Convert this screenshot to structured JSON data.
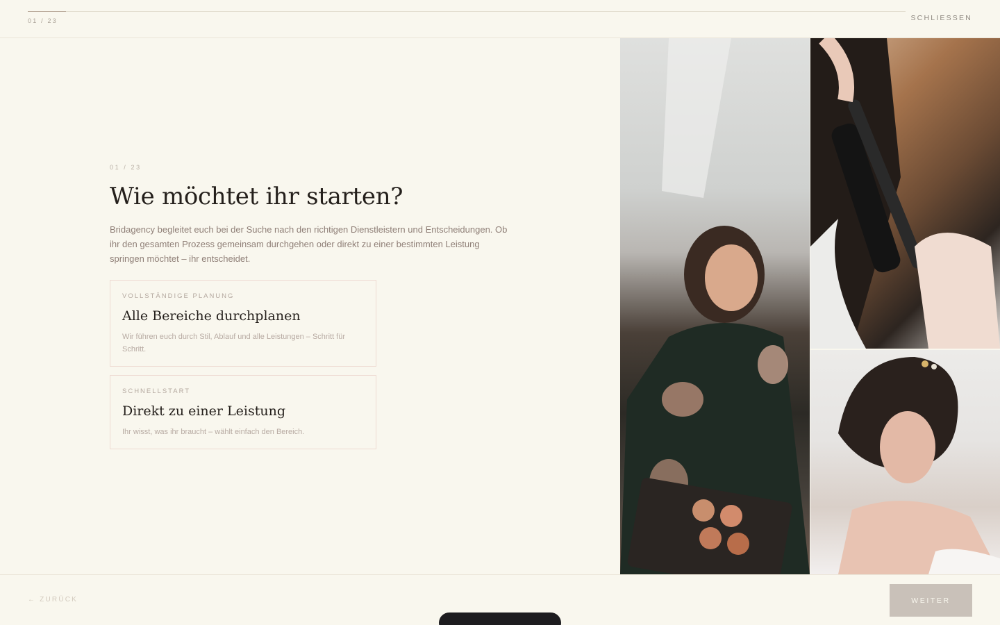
{
  "header": {
    "counter": "01 / 23",
    "progress": 0.0435,
    "close_label": "SCHLIESSEN"
  },
  "step": {
    "label": "01 / 23",
    "headline": "Wie möchtet ihr starten?",
    "intro": "Bridagency begleitet euch bei der Suche nach den richtigen Dienstleistern und Entscheidungen. Ob ihr den gesamten Prozess gemeinsam durchgehen oder direkt zu einer bestimmten Leistung springen möchtet – ihr entscheidet."
  },
  "options": [
    {
      "eyebrow": "Vollständige Planung",
      "title": "Alle Bereiche durchplanen",
      "description": "Wir führen euch durch Stil, Ablauf und alle Leistungen – Schritt für Schritt."
    },
    {
      "eyebrow": "Schnellstart",
      "title": "Direkt zu einer Leistung",
      "description": "Ihr wisst, was ihr braucht – wählt einfach den Bereich."
    }
  ],
  "footer": {
    "back_label": "← ZURÜCK",
    "next_label": "WEITER"
  }
}
